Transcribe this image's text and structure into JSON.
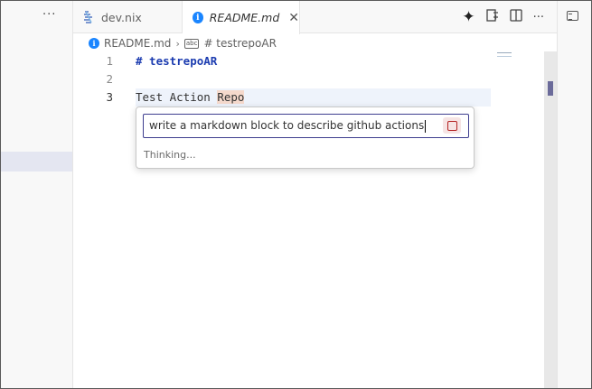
{
  "sidebar": {
    "more_label": "···"
  },
  "tabs": [
    {
      "label": "dev.nix",
      "active": false
    },
    {
      "label": "README.md",
      "active": true,
      "close_label": "✕"
    }
  ],
  "tab_actions": {
    "sparkle": "✦",
    "more": "···"
  },
  "breadcrumb": {
    "file": "README.md",
    "separator": "›",
    "symbol": "# testrepoAR",
    "symbol_icon_text": "abc"
  },
  "editor": {
    "lines": [
      {
        "number": "1",
        "text": "# testrepoAR"
      },
      {
        "number": "2",
        "text": ""
      },
      {
        "number": "3",
        "text_before": "Test Action ",
        "highlighted": "Repo"
      }
    ]
  },
  "inline_chat": {
    "input_value": "write a markdown block to describe github actions",
    "status": "Thinking..."
  },
  "colors": {
    "accent": "#1a85ff",
    "heading": "#1c3cb0",
    "stop": "#b42323"
  },
  "icons": [
    "nix-file-icon",
    "info-icon",
    "close-icon",
    "sparkle-icon",
    "diff-icon",
    "split-editor-icon",
    "more-icon",
    "symbol-string-icon",
    "stop-icon",
    "panel-icon"
  ]
}
